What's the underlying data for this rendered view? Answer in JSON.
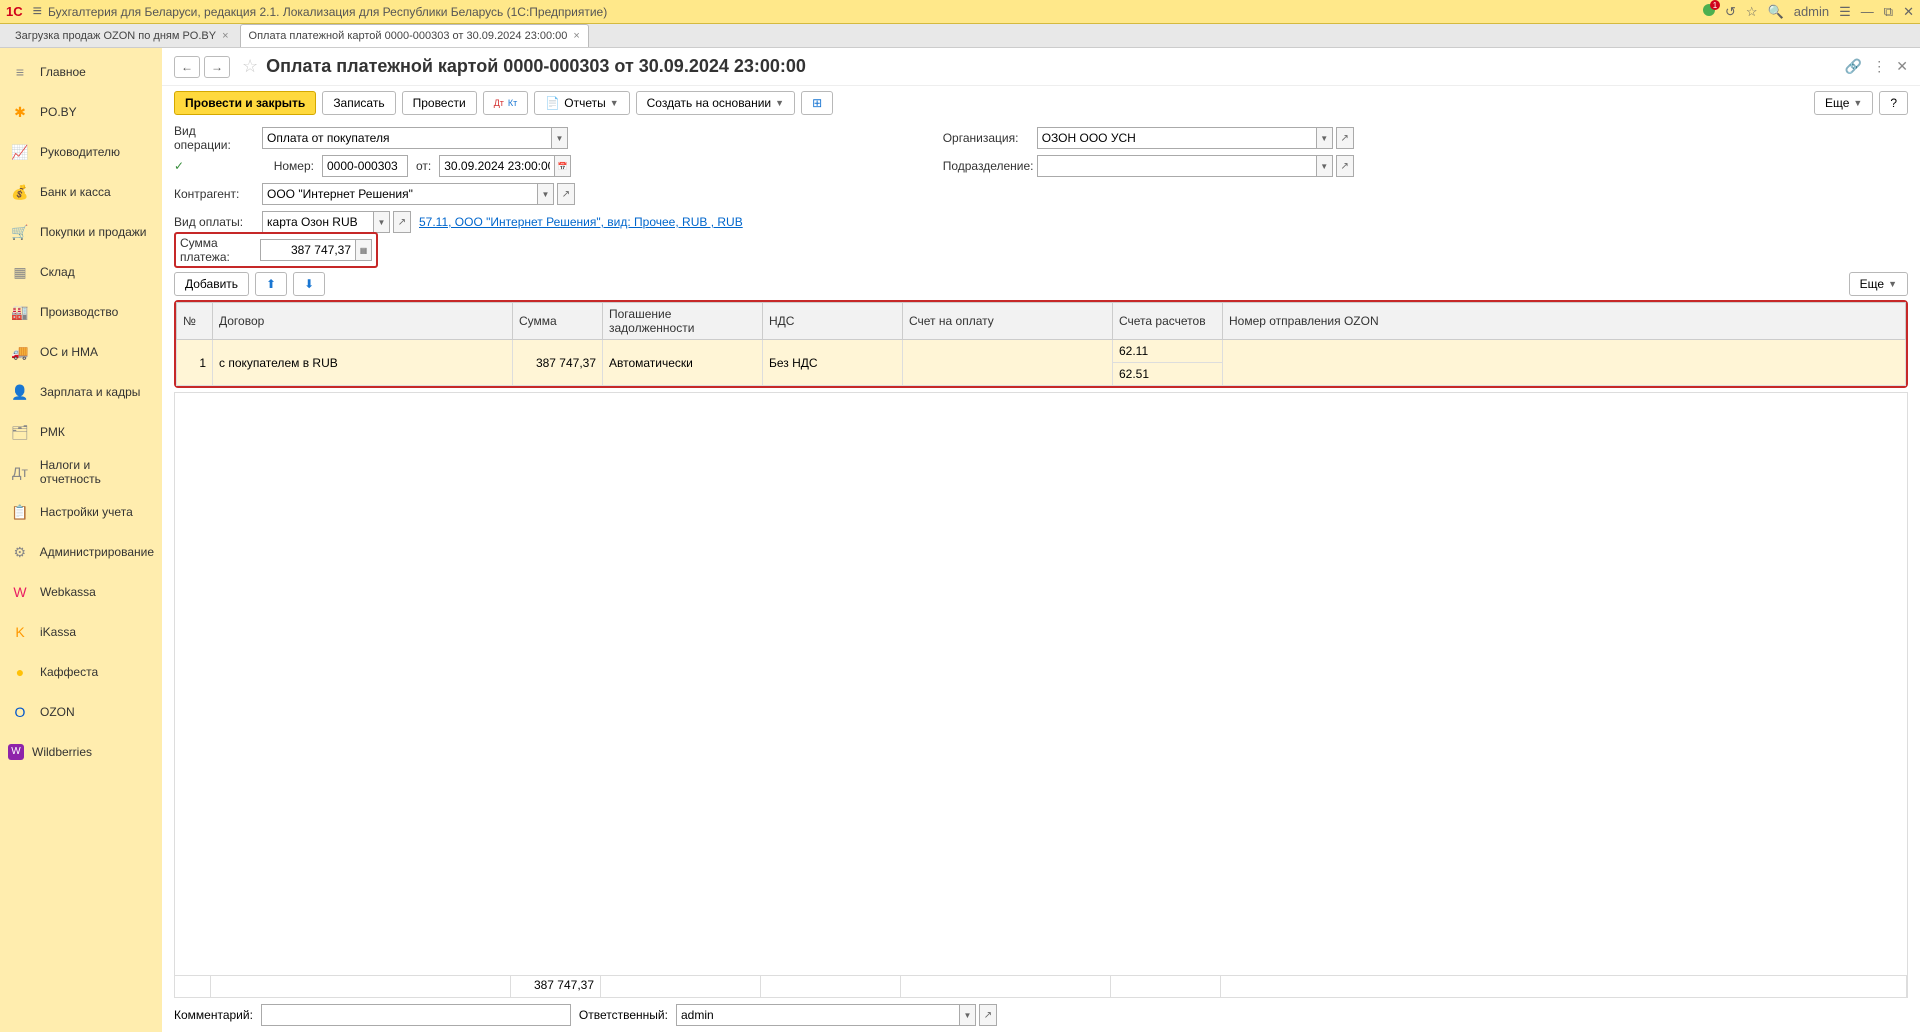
{
  "titlebar": {
    "app_title": "Бухгалтерия для Беларуси, редакция 2.1. Локализация для Республики Беларусь   (1C:Предприятие)",
    "user": "admin",
    "notif_count": "1"
  },
  "tabs": [
    {
      "label": "Загрузка продаж OZON по дням PO.BY",
      "active": false
    },
    {
      "label": "Оплата платежной картой 0000-000303 от 30.09.2024 23:00:00",
      "active": true
    }
  ],
  "sidebar": [
    {
      "icon": "≡",
      "label": "Главное"
    },
    {
      "icon": "✱",
      "label": "PO.BY"
    },
    {
      "icon": "📈",
      "label": "Руководителю"
    },
    {
      "icon": "💰",
      "label": "Банк и касса"
    },
    {
      "icon": "🛒",
      "label": "Покупки и продажи"
    },
    {
      "icon": "▦",
      "label": "Склад"
    },
    {
      "icon": "🏭",
      "label": "Производство"
    },
    {
      "icon": "🚚",
      "label": "ОС и НМА"
    },
    {
      "icon": "👤",
      "label": "Зарплата и кадры"
    },
    {
      "icon": "🗂",
      "label": "РМК"
    },
    {
      "icon": "Дт",
      "label": "Налоги и отчетность"
    },
    {
      "icon": "📋",
      "label": "Настройки учета"
    },
    {
      "icon": "⚙",
      "label": "Администрирование"
    },
    {
      "icon": "W",
      "label": "Webkassa"
    },
    {
      "icon": "K",
      "label": "iKassa"
    },
    {
      "icon": "●",
      "label": "Каффеста"
    },
    {
      "icon": "O",
      "label": "OZON"
    },
    {
      "icon": "W",
      "label": "Wildberries"
    }
  ],
  "page": {
    "title": "Оплата платежной картой 0000-000303 от 30.09.2024 23:00:00"
  },
  "toolbar": {
    "post_close": "Провести и закрыть",
    "write": "Записать",
    "post": "Провести",
    "reports": "Отчеты",
    "create_based": "Создать на основании",
    "more": "Еще"
  },
  "form": {
    "op_type_label": "Вид операции:",
    "op_type_value": "Оплата от покупателя",
    "number_label": "Номер:",
    "number_value": "0000-000303",
    "from_label": "от:",
    "date_value": "30.09.2024 23:00:00",
    "contragent_label": "Контрагент:",
    "contragent_value": "ООО \"Интернет Решения\"",
    "paytype_label": "Вид оплаты:",
    "paytype_value": "карта Озон RUB",
    "paylink": "57.11, ООО \"Интернет Решения\", вид: Прочее, RUB , RUB",
    "sum_label": "Сумма платежа:",
    "sum_value": "387 747,37",
    "org_label": "Организация:",
    "org_value": "ОЗОН ООО УСН",
    "dept_label": "Подразделение:",
    "dept_value": ""
  },
  "table_toolbar": {
    "add": "Добавить",
    "more": "Еще"
  },
  "table": {
    "headers": [
      "№",
      "Договор",
      "Сумма",
      "Погашение задолженности",
      "НДС",
      "Счет на оплату",
      "Счета расчетов",
      "Номер отправления OZON"
    ],
    "rows": [
      {
        "n": "1",
        "contract": "с покупателем в RUB",
        "sum": "387 747,37",
        "repay": "Автоматически",
        "vat": "Без НДС",
        "invoice": "",
        "acct1": "62.11",
        "acct2": "62.51",
        "ozon": ""
      }
    ],
    "footer_sum": "387 747,37"
  },
  "bottom": {
    "comment_label": "Комментарий:",
    "comment_value": "",
    "resp_label": "Ответственный:",
    "resp_value": "admin"
  }
}
